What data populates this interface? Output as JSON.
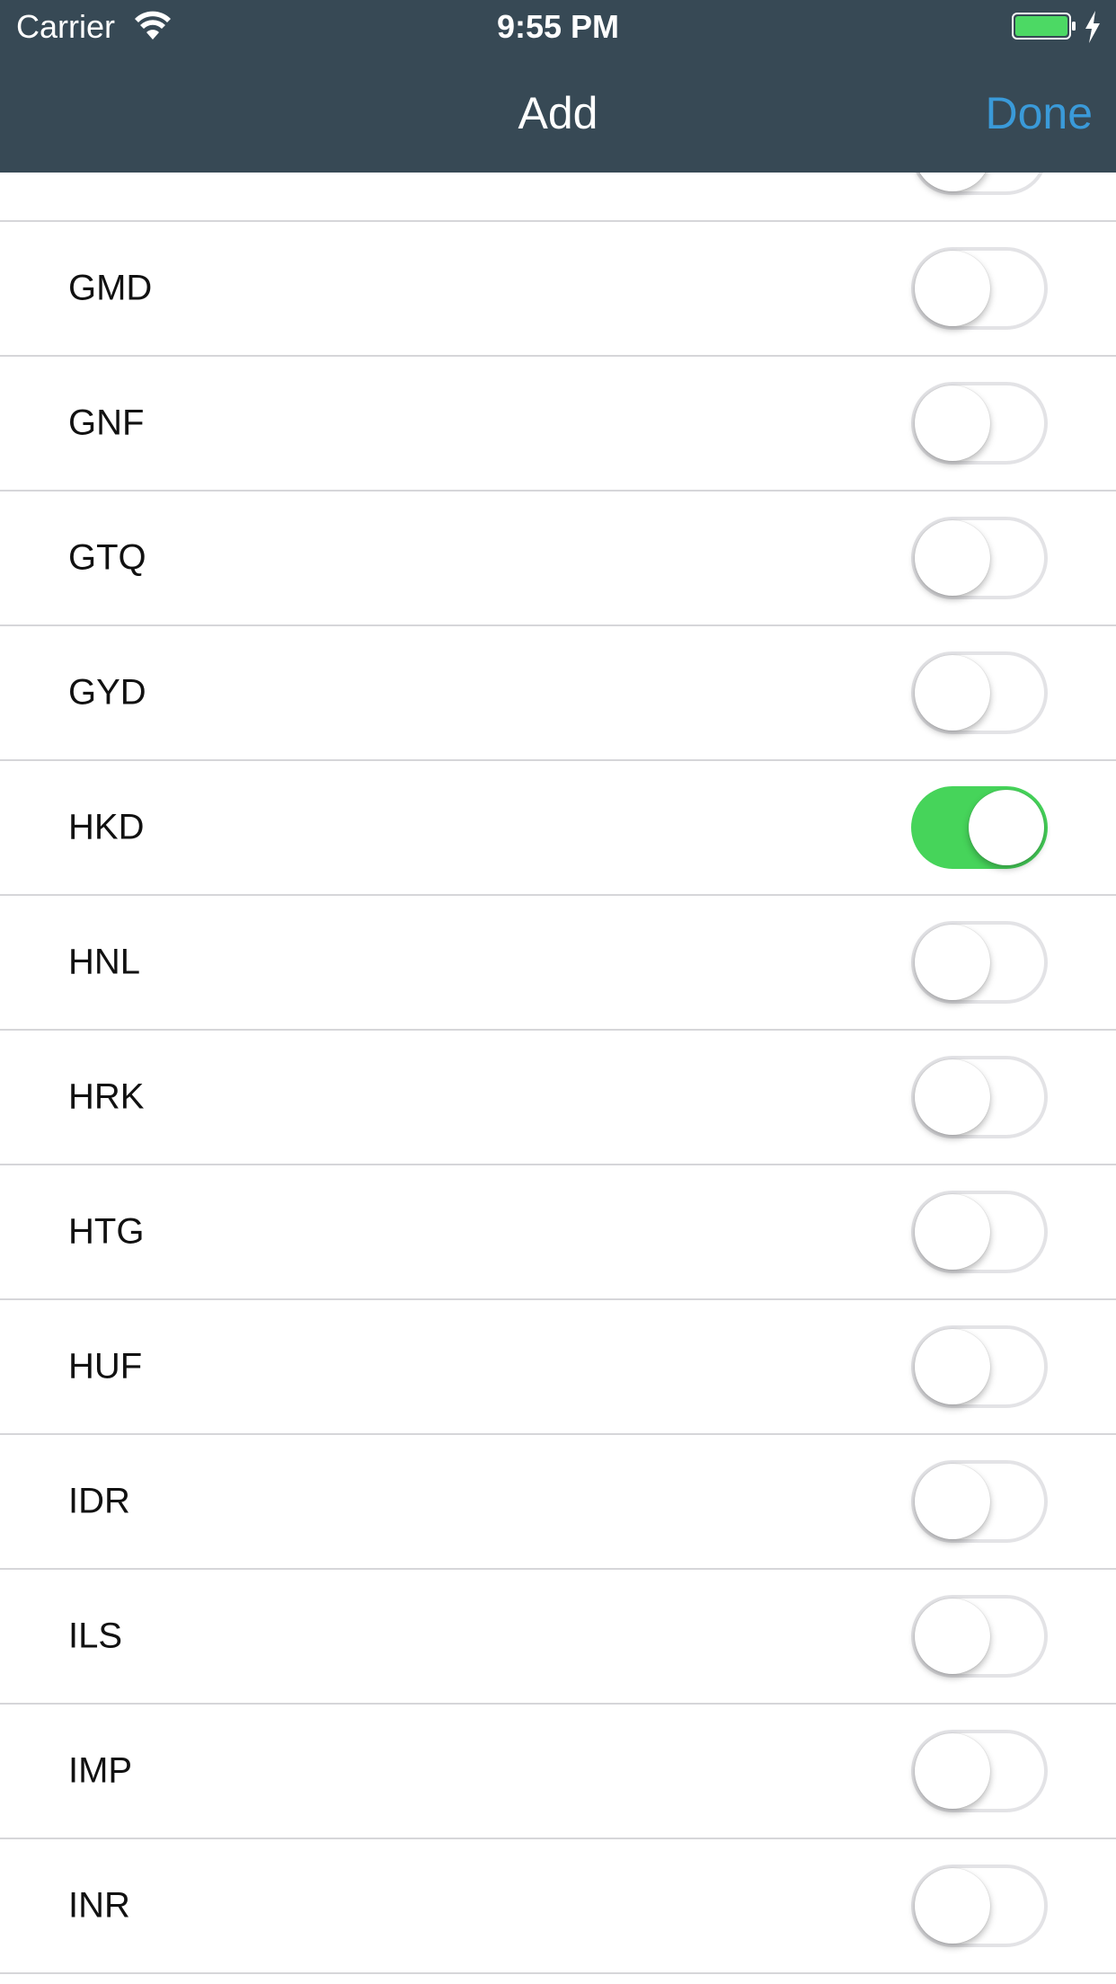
{
  "status_bar": {
    "carrier": "Carrier",
    "time": "9:55 PM"
  },
  "nav": {
    "title": "Add",
    "done_label": "Done"
  },
  "colors": {
    "nav_bg": "#374955",
    "accent": "#3a9ad9",
    "toggle_on": "#46d45a"
  },
  "currencies": [
    {
      "code": "",
      "on": false
    },
    {
      "code": "GMD",
      "on": false
    },
    {
      "code": "GNF",
      "on": false
    },
    {
      "code": "GTQ",
      "on": false
    },
    {
      "code": "GYD",
      "on": false
    },
    {
      "code": "HKD",
      "on": true
    },
    {
      "code": "HNL",
      "on": false
    },
    {
      "code": "HRK",
      "on": false
    },
    {
      "code": "HTG",
      "on": false
    },
    {
      "code": "HUF",
      "on": false
    },
    {
      "code": "IDR",
      "on": false
    },
    {
      "code": "ILS",
      "on": false
    },
    {
      "code": "IMP",
      "on": false
    },
    {
      "code": "INR",
      "on": false
    }
  ]
}
